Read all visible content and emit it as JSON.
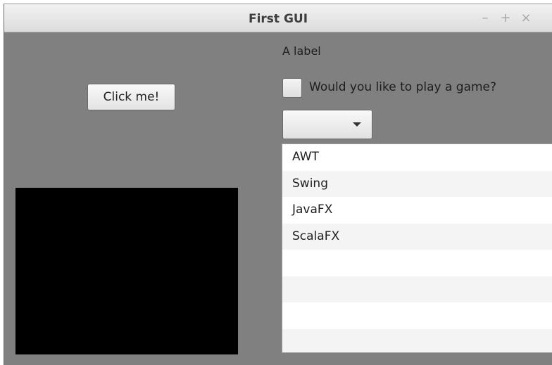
{
  "window": {
    "title": "First GUI",
    "controls": {
      "minimize": "–",
      "maximize": "+",
      "close": "×"
    }
  },
  "content": {
    "label_text": "A label",
    "button_label": "Click me!",
    "checkbox": {
      "label": "Would you like to play a game?",
      "checked": false
    },
    "combo_box": {
      "selected": ""
    },
    "list": {
      "items": [
        "AWT",
        "Swing",
        "JavaFX",
        "ScalaFX",
        "",
        "",
        "",
        ""
      ]
    }
  },
  "colors": {
    "window_background": "#808080",
    "canvas": "#000000",
    "list_background": "#ffffff",
    "list_alt_row": "#f4f4f4"
  }
}
